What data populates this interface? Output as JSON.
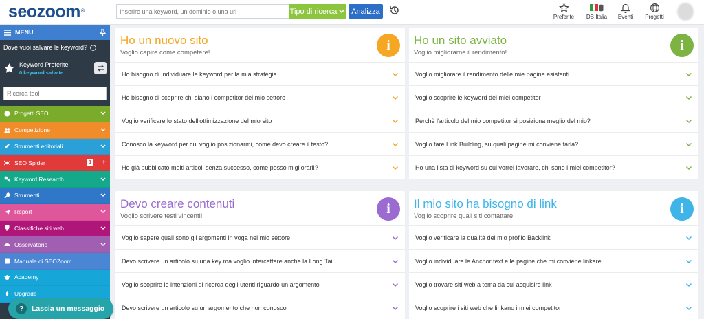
{
  "header": {
    "logo": "seozoom",
    "logo_mark": "®",
    "search_placeholder": "Inserire una keyword, un dominio o una url",
    "search_type_label": "Tipo di ricerca",
    "analyze_label": "Analizza",
    "icons": [
      "history-icon",
      "star-icon",
      "italy-flag-db-icon",
      "bell-icon",
      "globe-icon"
    ],
    "items": [
      {
        "label": "Preferite",
        "icon": "star-icon"
      },
      {
        "label": "DB Italia",
        "icon": "italy-flag-db-icon"
      },
      {
        "label": "Eventi",
        "icon": "bell-icon"
      },
      {
        "label": "Progetti",
        "icon": "globe-icon"
      }
    ]
  },
  "sidebar": {
    "menu_label": "MENU",
    "save_question": "Dove vuoi salvare le keyword?",
    "favorites_title": "Keyword Preferite",
    "favorites_count": "0 keyword salvate",
    "tool_search_placeholder": "Ricerca tool",
    "items": [
      {
        "label": "Progetti SEO",
        "color": "#7aab2a",
        "icon": "palette-icon"
      },
      {
        "label": "Competizione",
        "color": "#f08c2a",
        "icon": "users-icon"
      },
      {
        "label": "Strumenti editoriali",
        "color": "#2a9fd8",
        "icon": "pencil-icon"
      },
      {
        "label": "SEO Spider",
        "color": "#e03a3a",
        "icon": "spider-icon",
        "badge": "1"
      },
      {
        "label": "Keyword Research",
        "color": "#14a98a",
        "icon": "key-icon"
      },
      {
        "label": "Strumenti",
        "color": "#2f78c8",
        "icon": "wrench-icon"
      },
      {
        "label": "Report",
        "color": "#e0569b",
        "icon": "paper-plane-icon"
      },
      {
        "label": "Classifiche siti web",
        "color": "#b0167a",
        "icon": "trophy-icon"
      },
      {
        "label": "Osservatorio",
        "color": "#a05fb0",
        "icon": "gauge-icon"
      },
      {
        "label": "Manuale di SEOZoom",
        "color": "#4a86d4",
        "icon": "book-icon"
      },
      {
        "label": "Academy",
        "color": "#16a6d8",
        "icon": "graduation-icon"
      },
      {
        "label": "Upgrade",
        "color": "#16a6d8",
        "icon": "rocket-icon"
      }
    ]
  },
  "chat": {
    "label": "Lascia un messaggio"
  },
  "cards": [
    {
      "title": "Ho un nuovo sito",
      "subtitle": "Voglio capire come competere!",
      "color": "#f5a623",
      "questions": [
        "Ho bisogno di individuare le keyword per la mia strategia",
        "Ho bisogno di scoprire chi siano i competitor del mio settore",
        "Voglio verificare lo stato dell'ottimizzazione del mio sito",
        "Conosco la keyword per cui voglio posizionarmi, come devo creare il testo?",
        "Ho già pubblicato molti articoli senza successo, come posso migliorarli?"
      ]
    },
    {
      "title": "Ho un sito avviato",
      "subtitle": "Voglio migliorarne il rendimento!",
      "color": "#7cb342",
      "questions": [
        "Voglio migliorare il rendimento delle mie pagine esistenti",
        "Voglio scoprire le keyword dei miei competitor",
        "Perchè l'articolo del mio competitor si posiziona meglio del mio?",
        "Voglio fare Link Building, su quali pagine mi conviene farla?",
        "Ho una lista di keyword su cui vorrei lavorare, chi sono i miei competitor?"
      ]
    },
    {
      "title": "Devo creare contenuti",
      "subtitle": "Voglio scrivere testi vincenti!",
      "color": "#9b6bd1",
      "questions": [
        "Voglio sapere quali sono gli argomenti in voga nel mio settore",
        "Devo scrivere un articolo su una key ma voglio intercettare anche la Long Tail",
        "Voglio scoprire le intenzioni di ricerca degli utenti riguardo un argomento",
        "Devo scrivere un articolo su un argomento che non conosco"
      ]
    },
    {
      "title": "Il mio sito ha bisogno di link",
      "subtitle": "Voglio scoprire quali siti contattare!",
      "color": "#3fb4e8",
      "questions": [
        "Voglio verificare la qualità del mio profilo Backlink",
        "Voglio individuare le Anchor text e le pagine che mi conviene linkare",
        "Voglio trovare siti web a tema da cui acquisire link",
        "Voglio scoprire i siti web che linkano i miei competitor"
      ]
    }
  ]
}
